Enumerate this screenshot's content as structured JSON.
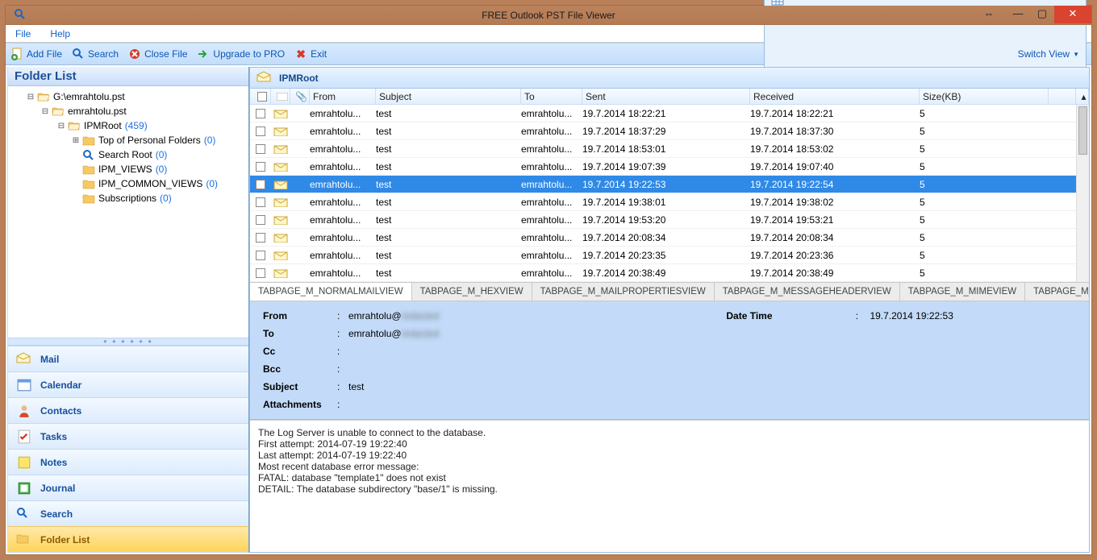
{
  "window": {
    "title": "FREE Outlook PST File Viewer"
  },
  "menu": {
    "file": "File",
    "help": "Help"
  },
  "toolbar": {
    "add_file": "Add File",
    "search": "Search",
    "close_file": "Close File",
    "upgrade": "Upgrade to PRO",
    "exit": "Exit",
    "switch_view": "Switch View"
  },
  "folder_panel": {
    "title": "Folder List",
    "tree": {
      "root": "G:\\emrahtolu.pst",
      "file": "emrahtolu.pst",
      "ipmroot": "IPMRoot",
      "ipmroot_count": "(459)",
      "top": "Top of Personal Folders",
      "top_count": "(0)",
      "search_root": "Search Root",
      "search_root_count": "(0)",
      "ipm_views": "IPM_VIEWS",
      "ipm_views_count": "(0)",
      "ipm_common": "IPM_COMMON_VIEWS",
      "ipm_common_count": "(0)",
      "subs": "Subscriptions",
      "subs_count": "(0)"
    }
  },
  "nav": {
    "mail": "Mail",
    "calendar": "Calendar",
    "contacts": "Contacts",
    "tasks": "Tasks",
    "notes": "Notes",
    "journal": "Journal",
    "search": "Search",
    "folder_list": "Folder List"
  },
  "crumb": {
    "title": "IPMRoot"
  },
  "columns": {
    "from": "From",
    "subject": "Subject",
    "to": "To",
    "sent": "Sent",
    "received": "Received",
    "size": "Size(KB)",
    "att": "📎"
  },
  "rows": [
    {
      "from": "emrahtolu...",
      "subject": "test",
      "to": "emrahtolu...",
      "sent": "19.7.2014 18:22:21",
      "recv": "19.7.2014 18:22:21",
      "size": "5"
    },
    {
      "from": "emrahtolu...",
      "subject": "test",
      "to": "emrahtolu...",
      "sent": "19.7.2014 18:37:29",
      "recv": "19.7.2014 18:37:30",
      "size": "5"
    },
    {
      "from": "emrahtolu...",
      "subject": "test",
      "to": "emrahtolu...",
      "sent": "19.7.2014 18:53:01",
      "recv": "19.7.2014 18:53:02",
      "size": "5"
    },
    {
      "from": "emrahtolu...",
      "subject": "test",
      "to": "emrahtolu...",
      "sent": "19.7.2014 19:07:39",
      "recv": "19.7.2014 19:07:40",
      "size": "5"
    },
    {
      "from": "emrahtolu...",
      "subject": "test",
      "to": "emrahtolu...",
      "sent": "19.7.2014 19:22:53",
      "recv": "19.7.2014 19:22:54",
      "size": "5",
      "selected": true
    },
    {
      "from": "emrahtolu...",
      "subject": "test",
      "to": "emrahtolu...",
      "sent": "19.7.2014 19:38:01",
      "recv": "19.7.2014 19:38:02",
      "size": "5"
    },
    {
      "from": "emrahtolu...",
      "subject": "test",
      "to": "emrahtolu...",
      "sent": "19.7.2014 19:53:20",
      "recv": "19.7.2014 19:53:21",
      "size": "5"
    },
    {
      "from": "emrahtolu...",
      "subject": "test",
      "to": "emrahtolu...",
      "sent": "19.7.2014 20:08:34",
      "recv": "19.7.2014 20:08:34",
      "size": "5"
    },
    {
      "from": "emrahtolu...",
      "subject": "test",
      "to": "emrahtolu...",
      "sent": "19.7.2014 20:23:35",
      "recv": "19.7.2014 20:23:36",
      "size": "5"
    },
    {
      "from": "emrahtolu...",
      "subject": "test",
      "to": "emrahtolu...",
      "sent": "19.7.2014 20:38:49",
      "recv": "19.7.2014 20:38:49",
      "size": "5"
    }
  ],
  "tabs": {
    "normal": "TABPAGE_M_NORMALMAILVIEW",
    "hex": "TABPAGE_M_HEXVIEW",
    "props": "TABPAGE_M_MAILPROPERTIESVIEW",
    "header": "TABPAGE_M_MESSAGEHEADERVIEW",
    "mime": "TABPAGE_M_MIMEVIEW",
    "html": "TABPAGE_M_HTMLVIEW"
  },
  "preview": {
    "labels": {
      "from": "From",
      "to": "To",
      "cc": "Cc",
      "bcc": "Bcc",
      "subject": "Subject",
      "att": "Attachments",
      "datetime": "Date Time"
    },
    "from": "emrahtolu@",
    "from_blur": "redacted",
    "to": "emrahtolu@",
    "to_blur": "redacted",
    "cc": "",
    "bcc": "",
    "subject": "test",
    "att": "",
    "datetime": "19.7.2014 19:22:53",
    "body": "The Log Server is unable to connect to the database.\nFirst attempt: 2014-07-19 19:22:40\nLast attempt: 2014-07-19 19:22:40\nMost recent database error message:\nFATAL:  database \"template1\" does not exist\nDETAIL:  The database subdirectory \"base/1\" is missing."
  }
}
